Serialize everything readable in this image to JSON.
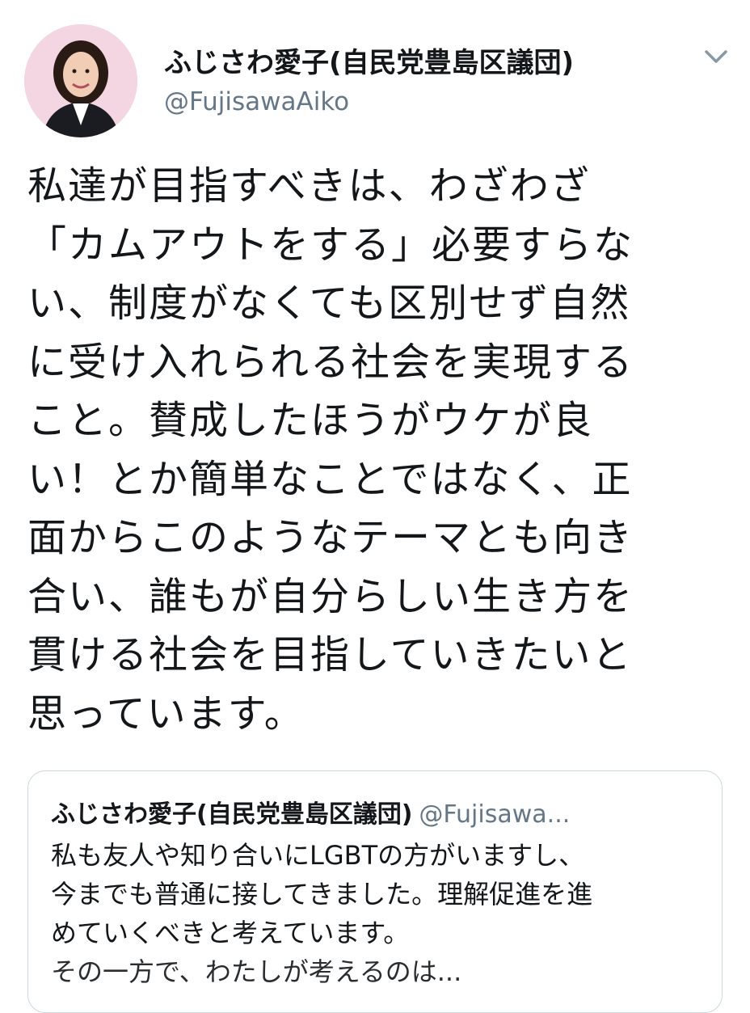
{
  "tweet": {
    "author": {
      "display_name": "ふじさわ愛子(自民党豊島区議団)",
      "handle": "@FujisawaAiko"
    },
    "menu_icon": "chevron-down-icon",
    "body_lines": [
      "私達が目指すべきは、わざわざ",
      "「カムアウトをする」必要すらな",
      "い、制度がなくても区別せず自然",
      "に受け入れられる社会を実現する",
      "こと。賛成したほうがウケが良",
      "い！とか簡単なことではなく、正",
      "面からこのようなテーマとも向き",
      "合い、誰もが自分らしい生き方を",
      "貫ける社会を目指していきたいと",
      "思っています。"
    ]
  },
  "quoted_tweet": {
    "display_name": "ふじさわ愛子(自民党豊島区議団)",
    "handle": "@Fujisawa...",
    "body_lines": [
      "私も友人や知り合いにLGBTの方がいますし、",
      "今までも普通に接してきました。理解促進を進",
      "めていくべきと考えています。",
      "その一方で、わたしが考えるのは..."
    ]
  },
  "colors": {
    "text": "#14171a",
    "secondary": "#657786",
    "border": "#ccd6dd",
    "avatar_bg": "#f4d6e3"
  }
}
